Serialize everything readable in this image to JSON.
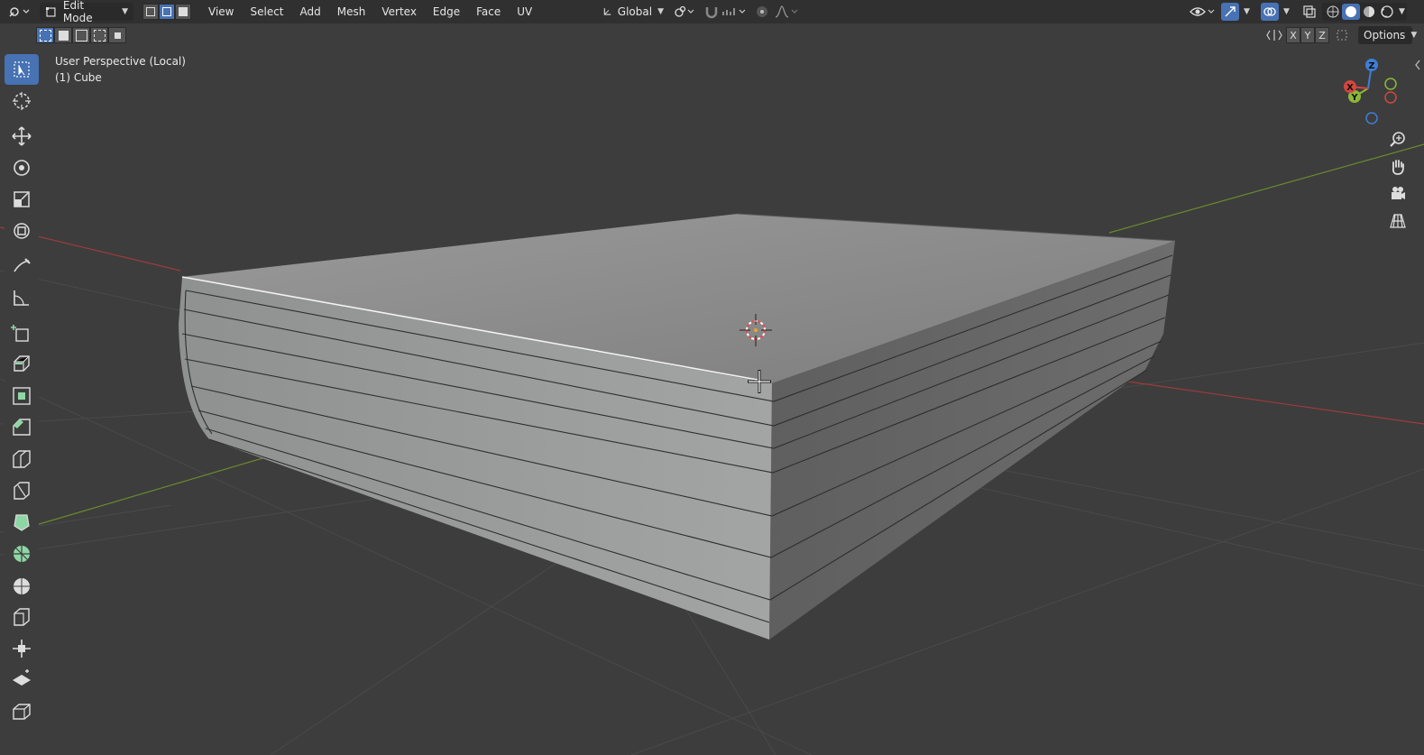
{
  "header": {
    "editor_type_icon": "editor-type-icon",
    "mode": "Edit Mode",
    "menus": [
      "View",
      "Select",
      "Add",
      "Mesh",
      "Vertex",
      "Edge",
      "Face",
      "UV"
    ],
    "transform_orientation": "Global",
    "options_label": "Options"
  },
  "axis_lock": [
    "X",
    "Y",
    "Z"
  ],
  "viewport": {
    "view_name": "User Perspective (Local)",
    "object_name": "(1) Cube"
  },
  "gizmo": {
    "z": "Z",
    "y": "Y",
    "x": "X"
  },
  "toolbar": {
    "tools": [
      "select-box",
      "cursor",
      "move",
      "rotate",
      "scale",
      "transform",
      "annotate",
      "measure",
      "add-cube",
      "extrude-region",
      "inset-faces",
      "bevel",
      "loop-cut",
      "knife",
      "poly-build",
      "spin",
      "smooth",
      "edge-slide",
      "shrink-fatten",
      "shear",
      "rip-region"
    ]
  },
  "colors": {
    "accent": "#4772b3",
    "background": "#3d3d3d",
    "header": "#303030",
    "x_axis": "#d4463f",
    "y_axis": "#8cb83a",
    "z_axis": "#3f7fd4"
  }
}
